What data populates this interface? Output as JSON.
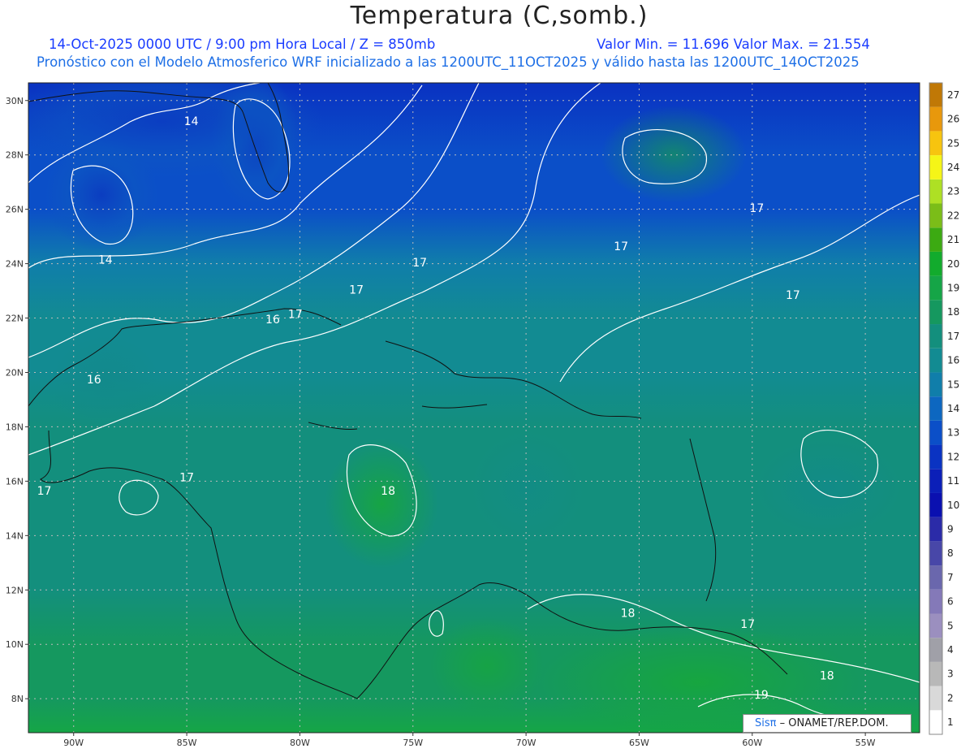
{
  "header": {
    "title": "Temperatura (C,somb.)",
    "line1_left": "14-Oct-2025  0000 UTC / 9:00 pm Hora Local / Z = 850mb",
    "line1_right": "Valor Min. = 11.696  Valor Max. = 21.554",
    "line2": "Pronóstico con el Modelo Atmosferico WRF inicializado a las 1200UTC_11OCT2025 y válido hasta las  1200UTC_14OCT2025"
  },
  "map": {
    "lat_labels": [
      "30N",
      "28N",
      "26N",
      "24N",
      "22N",
      "20N",
      "18N",
      "16N",
      "14N",
      "12N",
      "10N",
      "8N"
    ],
    "lon_labels": [
      "90W",
      "85W",
      "80W",
      "75W",
      "70W",
      "65W",
      "60W",
      "55W"
    ],
    "contour_labels": [
      {
        "text": "14",
        "lon": -84.8,
        "lat": 29.1
      },
      {
        "text": "14",
        "lon": -88.6,
        "lat": 24.0
      },
      {
        "text": "16",
        "lon": -81.2,
        "lat": 21.8
      },
      {
        "text": "17",
        "lon": -80.2,
        "lat": 22.0
      },
      {
        "text": "16",
        "lon": -89.1,
        "lat": 19.6
      },
      {
        "text": "17",
        "lon": -77.5,
        "lat": 22.9
      },
      {
        "text": "17",
        "lon": -74.7,
        "lat": 23.9
      },
      {
        "text": "17",
        "lon": -65.8,
        "lat": 24.5
      },
      {
        "text": "17",
        "lon": -59.8,
        "lat": 25.9
      },
      {
        "text": "17",
        "lon": -58.2,
        "lat": 22.7
      },
      {
        "text": "17",
        "lon": -91.3,
        "lat": 15.5
      },
      {
        "text": "17",
        "lon": -85.0,
        "lat": 16.0
      },
      {
        "text": "18",
        "lon": -76.1,
        "lat": 15.5
      },
      {
        "text": "18",
        "lon": -65.5,
        "lat": 11.0
      },
      {
        "text": "17",
        "lon": -60.2,
        "lat": 10.6
      },
      {
        "text": "18",
        "lon": -56.7,
        "lat": 8.7
      },
      {
        "text": "19",
        "lon": -59.6,
        "lat": 8.0
      }
    ],
    "shading_levels": [
      {
        "lat": 30.5,
        "value": 12.5
      },
      {
        "lat": 28,
        "value": 13.2
      },
      {
        "lat": 26,
        "value": 13.9
      },
      {
        "lat": 24,
        "value": 15.0
      },
      {
        "lat": 22,
        "value": 16.0
      },
      {
        "lat": 20,
        "value": 16.6
      },
      {
        "lat": 18,
        "value": 17.0
      },
      {
        "lat": 16,
        "value": 17.2
      },
      {
        "lat": 14,
        "value": 17.4
      },
      {
        "lat": 12,
        "value": 17.7
      },
      {
        "lat": 10,
        "value": 18.1
      },
      {
        "lat": 8,
        "value": 18.6
      },
      {
        "lat": 6.8,
        "value": 19.0
      }
    ]
  },
  "colorbar": {
    "labels": [
      "1",
      "2",
      "3",
      "4",
      "5",
      "6",
      "7",
      "8",
      "9",
      "10",
      "11",
      "12",
      "13",
      "14",
      "15",
      "16",
      "17",
      "18",
      "19",
      "20",
      "21",
      "22",
      "23",
      "24",
      "25",
      "26",
      "27"
    ],
    "colors": [
      "#ffffff",
      "#d9d9d9",
      "#b8b8b8",
      "#a0a0a8",
      "#9b8fbf",
      "#8479b8",
      "#6a67ad",
      "#4847a8",
      "#2b2ba8",
      "#0a10b0",
      "#0b1fb8",
      "#0a33c2",
      "#0b4fc8",
      "#0d67c0",
      "#107eaa",
      "#128b92",
      "#138f7d",
      "#15985f",
      "#15a547",
      "#12ab2d",
      "#3caa12",
      "#7bbd18",
      "#aee024",
      "#f5f517",
      "#f7c40f",
      "#e8980c",
      "#c07806"
    ]
  },
  "credit": {
    "logo": "Sisπ",
    "org": "– ONAMET/REP.DOM."
  }
}
